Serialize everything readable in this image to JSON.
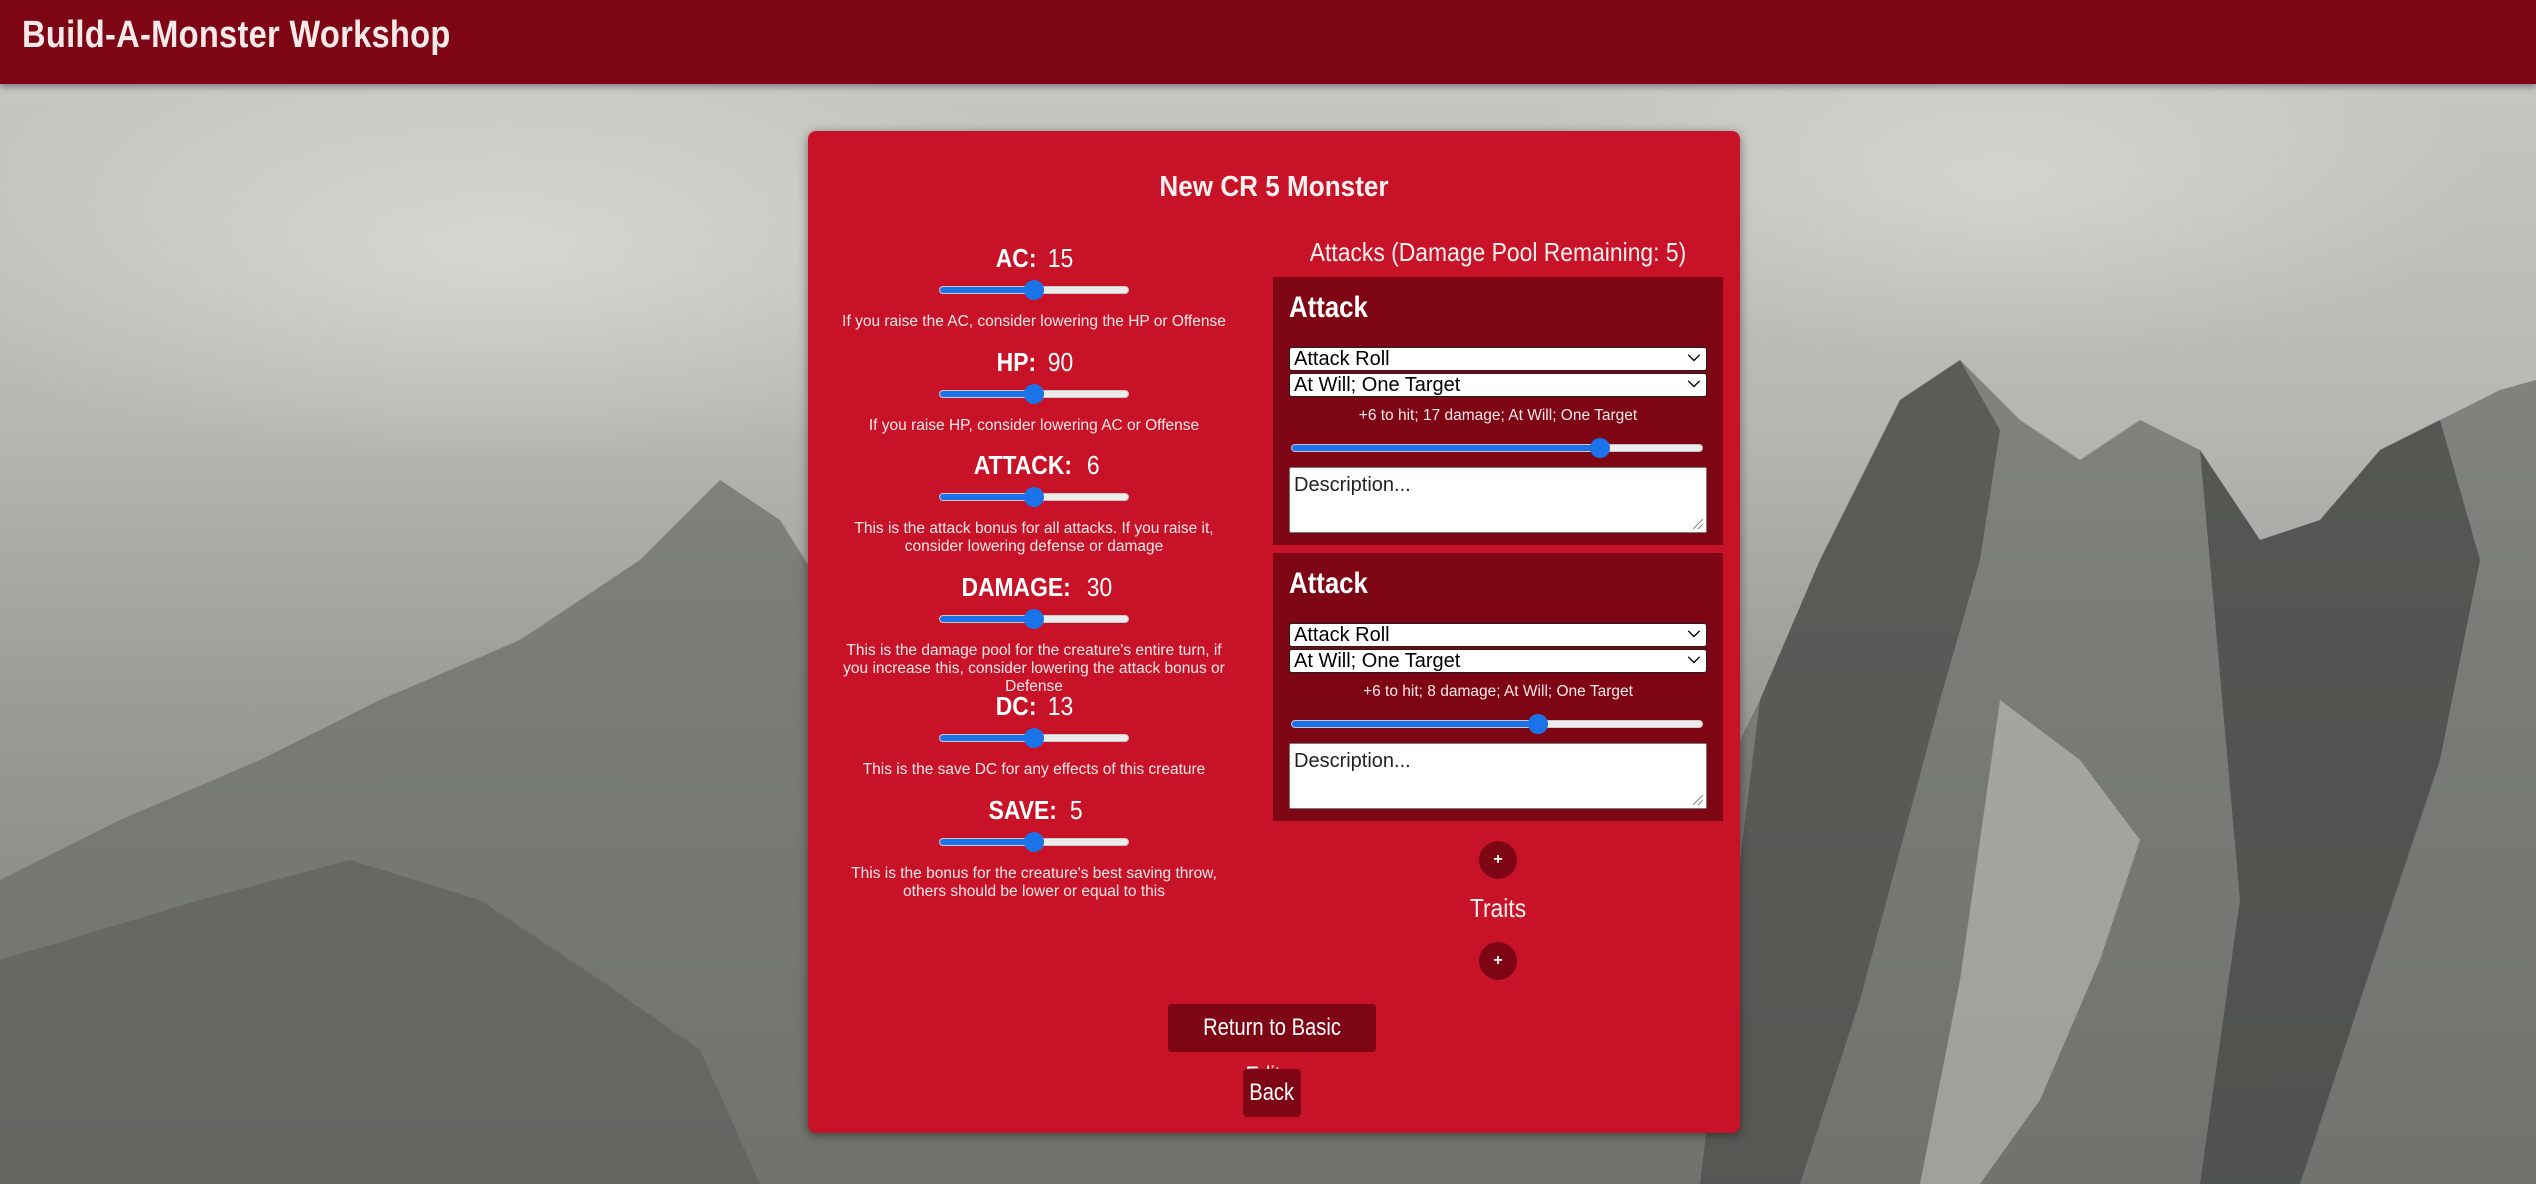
{
  "header": {
    "title": "Build-A-Monster Workshop"
  },
  "card": {
    "title": "New CR 5 Monster"
  },
  "stats": [
    {
      "label": "AC:",
      "value": "15",
      "level": 0.5,
      "hint": "If you raise the AC, consider lowering the HP or Offense"
    },
    {
      "label": "HP:",
      "value": "90",
      "level": 0.5,
      "hint": "If you raise HP, consider lowering AC or Offense"
    },
    {
      "label": "ATTACK:",
      "value": "6",
      "level": 0.5,
      "hint": "This is the attack bonus for all attacks. If you raise it, consider lowering defense or damage"
    },
    {
      "label": "DAMAGE:",
      "value": "30",
      "level": 0.5,
      "hint": "This is the damage pool for the creature's entire turn, if you increase this, consider lowering the attack bonus or Defense"
    },
    {
      "label": "DC:",
      "value": "13",
      "level": 0.5,
      "hint": "This is the save DC for any effects of this creature"
    },
    {
      "label": "SAVE:",
      "value": "5",
      "level": 0.5,
      "hint": "This is the bonus for the creature's best saving throw, others should be lower or equal to this"
    }
  ],
  "attacks": {
    "heading": "Attacks (Damage Pool Remaining: 5)",
    "items": [
      {
        "title": "Attack",
        "type": "Attack Roll",
        "usage": "At Will; One Target",
        "summary": "+6 to hit; 17 damage; At Will; One Target",
        "level": 0.75,
        "description_placeholder": "Description..."
      },
      {
        "title": "Attack",
        "type": "Attack Roll",
        "usage": "At Will; One Target",
        "summary": "+6 to hit; 8 damage; At Will; One Target",
        "level": 0.6,
        "description_placeholder": "Description..."
      }
    ],
    "add_label": "+"
  },
  "traits": {
    "heading": "Traits",
    "add_label": "+"
  },
  "buttons": {
    "return_label": "Return to Basic Editor",
    "back_label": "Back"
  },
  "colors": {
    "header": "#7e0614",
    "card": "#c81228",
    "slider": "#1a73e8"
  },
  "icons": {
    "dropdown": "chevron-down-icon",
    "resize": "resize-grip-icon"
  }
}
